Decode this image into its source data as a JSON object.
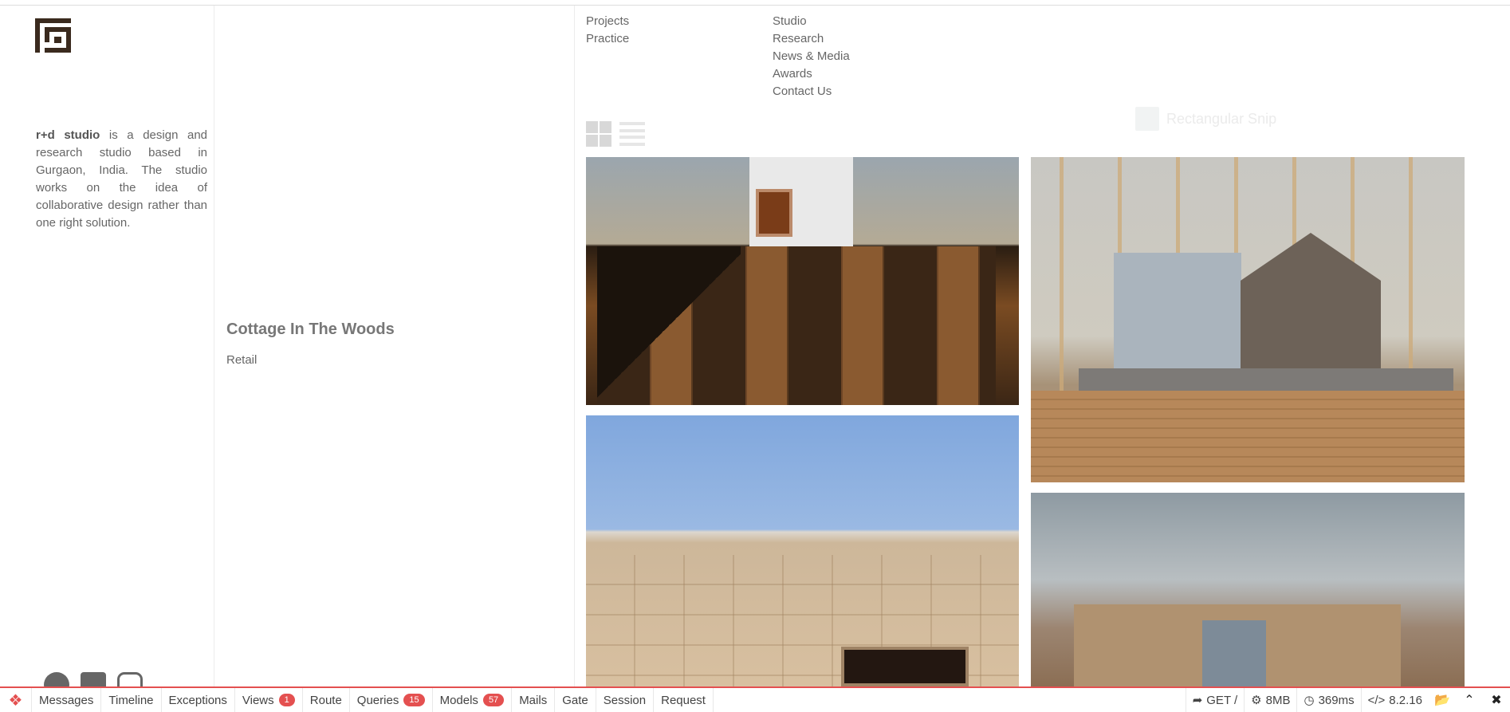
{
  "brand": {
    "name": "r+d studio"
  },
  "intro": {
    "text": " is a design and research studio based in Gurgaon, India. The studio works on the idea of collaborative design rather than one right solution."
  },
  "nav": {
    "col1": [
      "Projects",
      "Practice"
    ],
    "col2": [
      "Studio",
      "Research",
      "News & Media",
      "Awards",
      "Contact Us"
    ]
  },
  "project": {
    "title": "Cottage In The Woods",
    "category": "Retail"
  },
  "snip": {
    "label": "Rectangular Snip"
  },
  "social": [
    "facebook-icon",
    "linkedin-icon",
    "instagram-icon"
  ],
  "debugbar": {
    "tabs": [
      {
        "label": "Messages"
      },
      {
        "label": "Timeline"
      },
      {
        "label": "Exceptions"
      },
      {
        "label": "Views",
        "badge": "1"
      },
      {
        "label": "Route"
      },
      {
        "label": "Queries",
        "badge": "15"
      },
      {
        "label": "Models",
        "badge": "57"
      },
      {
        "label": "Mails"
      },
      {
        "label": "Gate"
      },
      {
        "label": "Session"
      },
      {
        "label": "Request"
      }
    ],
    "method": "GET /",
    "memory": "8MB",
    "time": "369ms",
    "version": "8.2.16"
  },
  "colors": {
    "accent": "#e45050",
    "logo": "#3a2a1e"
  }
}
